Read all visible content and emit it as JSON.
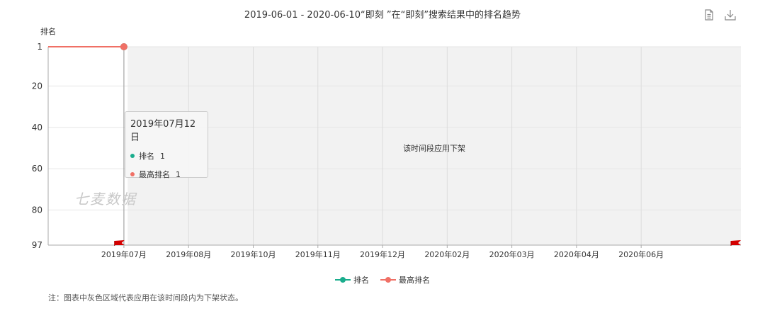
{
  "toolbar": {
    "icons": [
      "document-icon",
      "download-icon"
    ]
  },
  "watermark": "七麦数据",
  "tooltip": {
    "date": "2019年07月12日",
    "rows": [
      {
        "label": "排名",
        "value": "1",
        "color": "#1aad8d"
      },
      {
        "label": "最高排名",
        "value": "1",
        "color": "#f07066"
      }
    ]
  },
  "note": "注：图表中灰色区域代表应用在该时间段内为下架状态。",
  "chart_data": {
    "type": "line",
    "title": "2019-06-01 - 2020-06-10“即刻 ”在“即刻”搜索结果中的排名趋势",
    "ylabel": "排名",
    "y_inverted": true,
    "ylim": [
      1,
      97
    ],
    "yticks": [
      1,
      20,
      40,
      60,
      80,
      97
    ],
    "xlim": [
      "2019-06-01",
      "2020-06-10"
    ],
    "xticks": [
      {
        "label": "2019年07月",
        "date": "2019-07-12"
      },
      {
        "label": "2019年08月",
        "date": "2019-08-16"
      },
      {
        "label": "2019年10月",
        "date": "2019-09-20"
      },
      {
        "label": "2019年11月",
        "date": "2019-10-25"
      },
      {
        "label": "2019年12月",
        "date": "2019-11-29"
      },
      {
        "label": "2020年02月",
        "date": "2020-01-03"
      },
      {
        "label": "2020年03月",
        "date": "2020-02-07"
      },
      {
        "label": "2020年04月",
        "date": "2020-03-13"
      },
      {
        "label": "2020年06月",
        "date": "2020-04-17"
      }
    ],
    "grid": true,
    "series": [
      {
        "name": "排名",
        "color": "#1aad8d",
        "points": [
          [
            "2019-06-01",
            1
          ],
          [
            "2019-07-12",
            1
          ]
        ]
      },
      {
        "name": "最高排名",
        "color": "#f07066",
        "points": [
          [
            "2019-06-01",
            1
          ],
          [
            "2019-07-12",
            1
          ]
        ]
      }
    ],
    "delisted_periods": [
      {
        "start": "2019-07-14",
        "end": "2020-06-10",
        "label": "该时间段应用下架"
      }
    ],
    "flag_markers": [
      "2019-07-10",
      "2020-06-10"
    ],
    "highlight_date": "2019-07-12",
    "legend_position": "bottom"
  }
}
